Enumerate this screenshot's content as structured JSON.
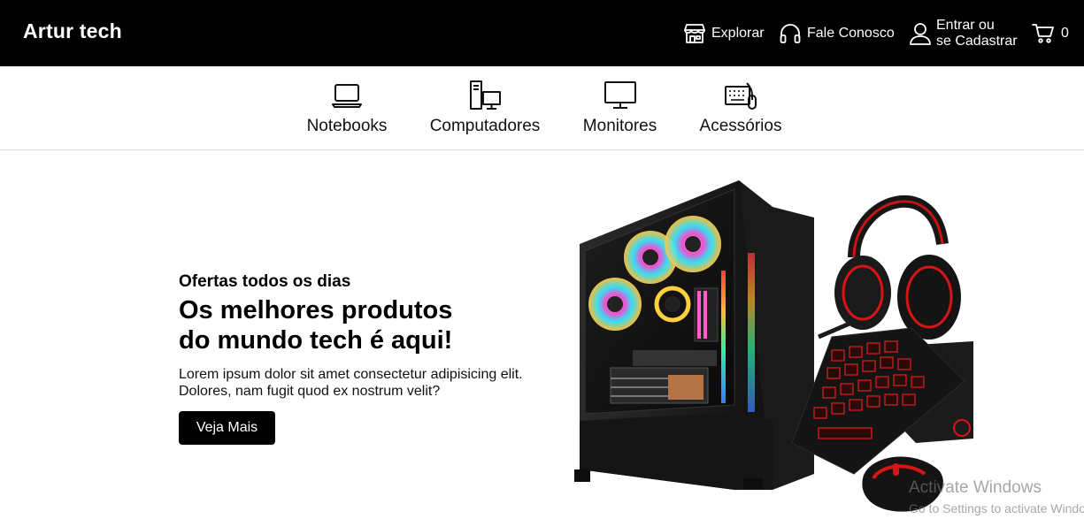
{
  "header": {
    "brand": "Artur tech",
    "nav": {
      "explore": "Explorar",
      "contact": "Fale Conosco",
      "login_line1": "Entrar ou",
      "login_line2": "se Cadastrar",
      "cart_count": "0"
    },
    "icons": [
      "store-icon",
      "headphones-icon",
      "user-icon",
      "cart-icon"
    ]
  },
  "categories": [
    {
      "label": "Notebooks",
      "icon": "laptop-icon"
    },
    {
      "label": "Computadores",
      "icon": "desktop-computer-icon"
    },
    {
      "label": "Monitores",
      "icon": "monitor-icon"
    },
    {
      "label": "Acessórios",
      "icon": "keyboard-mouse-icon"
    }
  ],
  "hero": {
    "eyebrow": "Ofertas todos os dias",
    "title_line1": "Os melhores produtos",
    "title_line2": "do mundo tech é aqui!",
    "desc_line1": "Lorem ipsum dolor sit amet consectetur adipisicing elit.",
    "desc_line2": "Dolores, nam fugit quod ex nostrum velit?",
    "cta": "Veja Mais"
  },
  "watermark": {
    "title": "Activate Windows",
    "subtitle": "Go to Settings to activate Windows."
  },
  "colors": {
    "header_bg": "#000000",
    "button_bg": "#000000",
    "accent_red": "#d91414"
  }
}
